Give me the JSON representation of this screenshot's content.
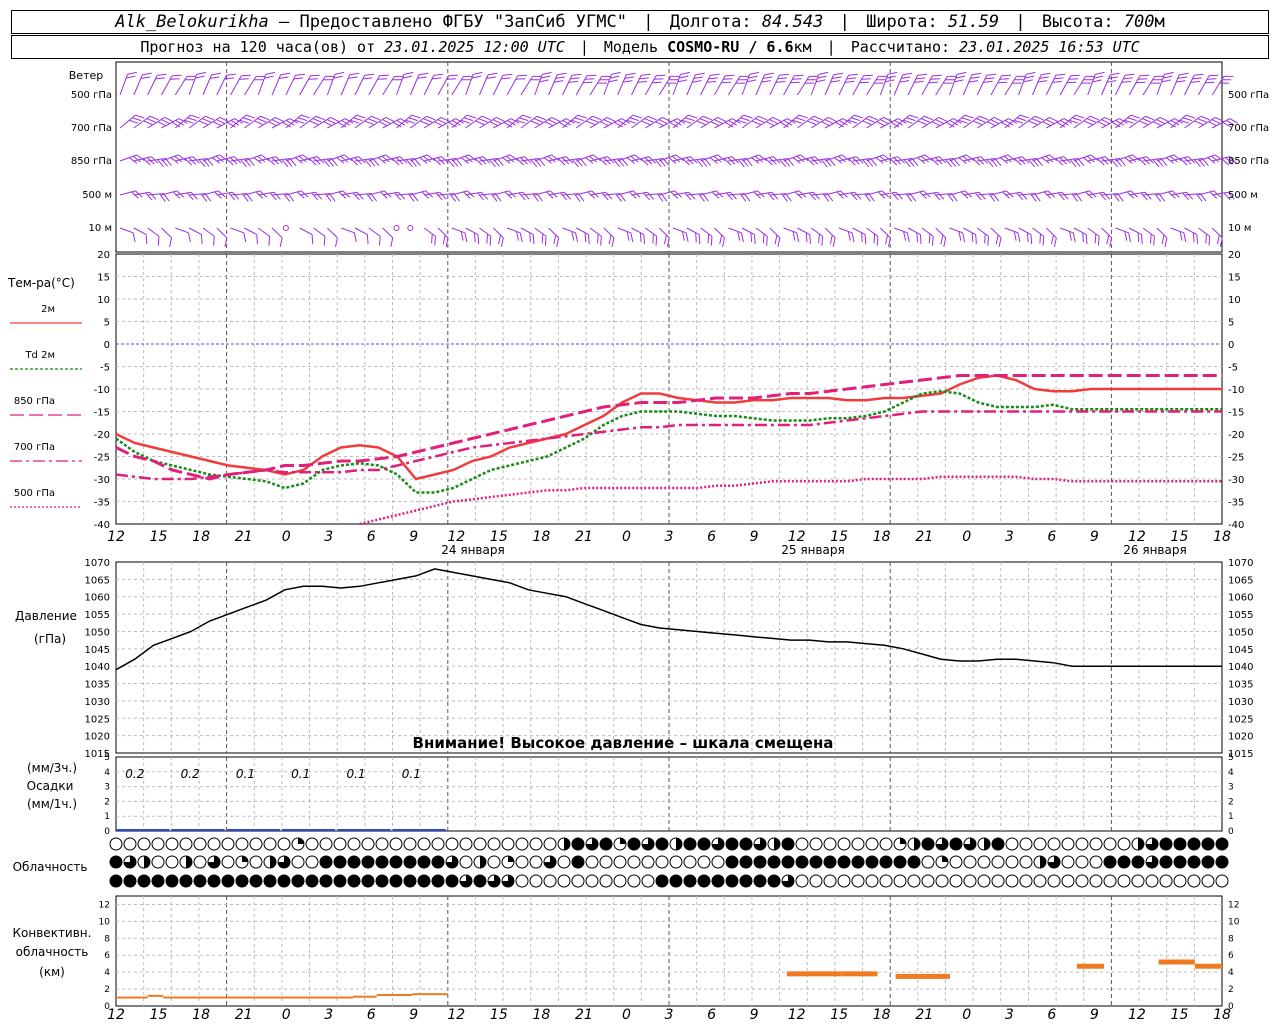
{
  "header": {
    "station": "Alk_Belokurikha",
    "provided": "– Предоставлено ФГБУ \"ЗапСиб УГМС\"",
    "lon_label": "Долгота:",
    "lon": "84.543",
    "lat_label": "Широта:",
    "lat": "51.59",
    "alt_label": "Высота:",
    "alt": "700",
    "alt_unit": "м",
    "forecast_label": "Прогноз на 120 часа(ов) от",
    "forecast_start": "23.01.2025 12:00 UTC",
    "model_label": "Модель",
    "model": "COSMO-RU / 6.6",
    "model_unit": "км",
    "calc_label": "Рассчитано:",
    "calc_time": "23.01.2025 16:53 UTC"
  },
  "time_axis": {
    "hours": [
      "12",
      "15",
      "18",
      "21",
      "0",
      "3",
      "6",
      "9",
      "12",
      "15",
      "18",
      "21",
      "0",
      "3",
      "6",
      "9",
      "12",
      "15",
      "18",
      "21",
      "0",
      "3",
      "6",
      "9",
      "12",
      "15",
      "18"
    ],
    "days": [
      "24 января",
      "25 января",
      "26 января"
    ]
  },
  "wind": {
    "title": "Ветер",
    "levels": [
      "500 гПа",
      "700 гПа",
      "850 гПа",
      "500 м",
      "10  м"
    ],
    "color": "#9b30e0"
  },
  "temperature": {
    "title": "Тем-ра(°С)",
    "legend": [
      {
        "label": "2м",
        "color": "#f03c3c"
      },
      {
        "label": "2м",
        "prefix": "Td",
        "color": "#188a18"
      },
      {
        "label": "850 гПа",
        "color": "#e0207a"
      },
      {
        "label": "700 гПа",
        "color": "#e0207a"
      },
      {
        "label": "500 гПа",
        "color": "#e0207a"
      }
    ],
    "ticks": [
      "20",
      "15",
      "10",
      "5",
      "0",
      "-5",
      "-10",
      "-15",
      "-20",
      "-25",
      "-30",
      "-35",
      "-40"
    ]
  },
  "pressure": {
    "title": "Давление",
    "unit": "(гПа)",
    "ticks": [
      "1070",
      "1065",
      "1060",
      "1055",
      "1050",
      "1045",
      "1040",
      "1035",
      "1030",
      "1025",
      "1020",
      "1015"
    ],
    "warning": "Внимание! Высокое давление – шкала смещена"
  },
  "precip": {
    "unit3": "(мм/3ч.)",
    "title": "Осадки",
    "unit1": "(мм/1ч.)",
    "ticks": [
      "5",
      "4",
      "3",
      "2",
      "1",
      "0"
    ],
    "amounts": [
      "0.2",
      "0.2",
      "0.1",
      "0.1",
      "0.1",
      "0.1"
    ]
  },
  "cloud": {
    "title": "Облачность"
  },
  "convective": {
    "title1": "Конвективн.",
    "title2": "облачность",
    "unit": "(км)",
    "ticks": [
      "12",
      "10",
      "8",
      "6",
      "4",
      "2",
      "0"
    ]
  },
  "chart_data": [
    {
      "type": "line",
      "title": "Тем-ра(°С)",
      "ylim": [
        -40,
        20
      ],
      "x_hours": [
        0,
        3,
        6,
        9,
        12,
        15,
        18,
        21,
        24,
        27,
        30,
        33,
        36,
        39,
        42,
        45,
        48,
        51,
        54,
        57,
        60,
        63,
        66,
        69,
        72,
        75,
        78,
        81,
        84,
        87,
        90,
        93,
        96,
        99,
        102,
        105,
        108,
        111,
        114,
        117,
        120,
        123,
        126,
        129,
        132,
        135,
        138,
        141,
        144,
        147,
        150,
        153,
        156,
        159,
        162,
        165,
        168,
        171,
        174,
        177
      ],
      "series": [
        {
          "name": "2м",
          "color": "#f03c3c",
          "values": [
            -20,
            -22,
            -23,
            -24,
            -25,
            -26,
            -27,
            -27.5,
            -28,
            -29,
            -28,
            -25,
            -23,
            -22.5,
            -23,
            -25,
            -30,
            -29,
            -28,
            -26,
            -25,
            -23,
            -22,
            -21,
            -20,
            -18,
            -16,
            -13,
            -11,
            -11,
            -12,
            -12.5,
            -13,
            -13,
            -12.5,
            -12.5,
            -12,
            -12,
            -12,
            -12.5,
            -12.5,
            -12,
            -12,
            -11.5,
            -11,
            -9,
            -7.5,
            -7,
            -8,
            -10,
            -10.5,
            -10.5,
            -10,
            -10,
            -10,
            -10,
            -10,
            -10,
            -10,
            -10
          ]
        },
        {
          "name": "2м",
          "color": "#188a18",
          "values": [
            -21,
            -24,
            -26,
            -27,
            -28,
            -29,
            -29.5,
            -30,
            -30.5,
            -32,
            -31,
            -28,
            -27,
            -26.5,
            -27,
            -29,
            -33,
            -33,
            -32,
            -30,
            -28,
            -27,
            -26,
            -25,
            -23,
            -21,
            -18,
            -16,
            -15,
            -15,
            -15,
            -15.5,
            -16,
            -16,
            -16.5,
            -17,
            -17,
            -17,
            -16.5,
            -16.5,
            -16,
            -15,
            -13,
            -11,
            -10.5,
            -11,
            -13,
            -14,
            -14,
            -14,
            -13.5,
            -14.5,
            -14.5,
            -14.5,
            -14.5,
            -14.5,
            -14.5,
            -14.5,
            -14.5,
            -14.5
          ]
        },
        {
          "name": "850 гПа",
          "color": "#e0207a",
          "values": [
            -23,
            -25,
            -26,
            -28,
            -29,
            -30,
            -29,
            -28.5,
            -28,
            -27,
            -27,
            -26.5,
            -26,
            -26,
            -25.5,
            -25,
            -24,
            -23,
            -22,
            -21,
            -20,
            -19,
            -18,
            -17,
            -16,
            -15,
            -14,
            -13.5,
            -13,
            -13,
            -13,
            -12.5,
            -12,
            -12,
            -12,
            -11.5,
            -11,
            -11,
            -10.5,
            -10,
            -9.5,
            -9,
            -8.5,
            -8,
            -7.5,
            -7,
            -7,
            -7,
            -7,
            -7,
            -7,
            -7,
            -7,
            -7,
            -7,
            -7,
            -7,
            -7,
            -7,
            -7
          ]
        },
        {
          "name": "700 гПа",
          "color": "#e0207a",
          "values": [
            -29,
            -29.5,
            -30,
            -30,
            -30,
            -29.5,
            -29,
            -28.5,
            -28,
            -28.5,
            -28.5,
            -28.5,
            -28.5,
            -28,
            -28,
            -27,
            -26,
            -25,
            -24,
            -23,
            -22.5,
            -22,
            -21.5,
            -21,
            -20.5,
            -20,
            -19.5,
            -19,
            -18.5,
            -18.5,
            -18,
            -18,
            -18,
            -18,
            -18,
            -18,
            -18,
            -18,
            -17.5,
            -17,
            -16.5,
            -16,
            -15.5,
            -15,
            -15,
            -15,
            -15,
            -15,
            -15,
            -15,
            -15,
            -15,
            -15,
            -15,
            -15,
            -15,
            -15,
            -15,
            -15,
            -15
          ]
        },
        {
          "name": "500 гПа",
          "color": "#e0207a",
          "values": [
            null,
            null,
            null,
            null,
            null,
            null,
            null,
            null,
            null,
            null,
            null,
            null,
            null,
            -40,
            -39,
            -38,
            -37,
            -36,
            -35,
            -34.5,
            -34,
            -33.5,
            -33,
            -32.5,
            -32.5,
            -32,
            -32,
            -32,
            -32,
            -32,
            -32,
            -32,
            -31.5,
            -31.5,
            -31,
            -30.5,
            -30.5,
            -30.5,
            -30.5,
            -30.5,
            -30,
            -30,
            -30,
            -30,
            -29.5,
            -29.5,
            -29.5,
            -29.5,
            -29.5,
            -30,
            -30,
            -30.5,
            -30.5,
            -30.5,
            -30.5,
            -30.5,
            -30.5,
            -30.5,
            -30.5,
            -30.5
          ]
        }
      ]
    },
    {
      "type": "line",
      "title": "Давление",
      "ylim": [
        1015,
        1070
      ],
      "series": [
        {
          "name": "",
          "color": "#000000",
          "values": [
            1039,
            1042,
            1046,
            1048,
            1050,
            1053,
            1055,
            1057,
            1059,
            1062,
            1063,
            1063,
            1062.5,
            1063,
            1064,
            1065,
            1066,
            1068,
            1067,
            1066,
            1065,
            1064,
            1062,
            1061,
            1060,
            1058,
            1056,
            1054,
            1052,
            1051,
            1050.5,
            1050,
            1049.5,
            1049,
            1048.5,
            1048,
            1047.5,
            1047.5,
            1047,
            1047,
            1046.5,
            1046,
            1045,
            1043.5,
            1042,
            1041.5,
            1041.5,
            1042,
            1042,
            1041.5,
            1041,
            1040,
            1040,
            1040,
            1040,
            1040,
            1040,
            1040,
            1040,
            1040
          ]
        }
      ]
    },
    {
      "type": "bar",
      "title": "Осадки",
      "ylim": [
        0,
        5
      ],
      "values_mm_3h": [
        0.2,
        0.2,
        0.1,
        0.1,
        0.1,
        0.1
      ]
    },
    {
      "type": "bar",
      "title": "Конвективн. облачность",
      "ylim": [
        0,
        12
      ],
      "values_km": [
        1.0,
        1.2,
        1.0,
        1.0,
        1.0,
        1.0,
        1.0,
        1.0,
        1.4,
        1.4,
        1.4,
        1.4,
        1.2,
        1.2,
        1.3,
        1.4,
        1.4,
        1.4,
        3.8,
        3.8,
        3.5,
        4.7,
        5.2,
        5.2,
        4.7
      ]
    }
  ]
}
